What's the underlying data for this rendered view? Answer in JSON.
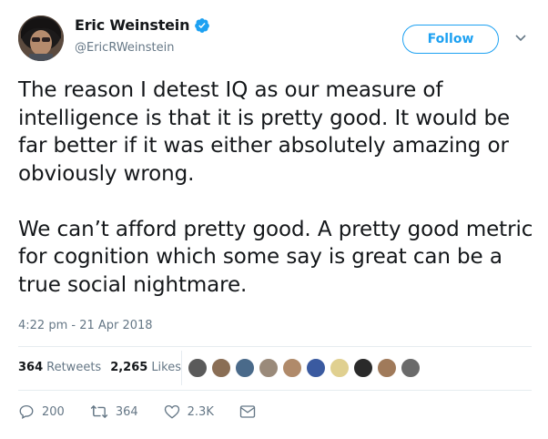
{
  "header": {
    "display_name": "Eric Weinstein",
    "handle": "@EricRWeinstein",
    "follow_label": "Follow"
  },
  "tweet": {
    "text": "The reason I detest IQ as our measure of intelligence is that it is pretty good. It would be far better if it was either absolutely amazing or obviously wrong.\n\nWe can’t afford pretty good. A pretty good metric for cognition which some say is great can be a true social nightmare.",
    "timestamp": "4:22 pm - 21 Apr 2018"
  },
  "stats": {
    "retweets_count": "364",
    "retweets_label": "Retweets",
    "likes_count": "2,265",
    "likes_label": "Likes"
  },
  "liker_avatar_colors": [
    "#5a5a5a",
    "#8a6e55",
    "#4a6a8a",
    "#9a8a7a",
    "#b08a6a",
    "#3a5aa0",
    "#e0d090",
    "#2a2a2a",
    "#a07a5a",
    "#6a6a6a"
  ],
  "actions": {
    "reply_count": "200",
    "retweet_count": "364",
    "like_count": "2.3K"
  },
  "colors": {
    "accent": "#1da1f2",
    "text": "#14171a",
    "secondary": "#657786"
  }
}
